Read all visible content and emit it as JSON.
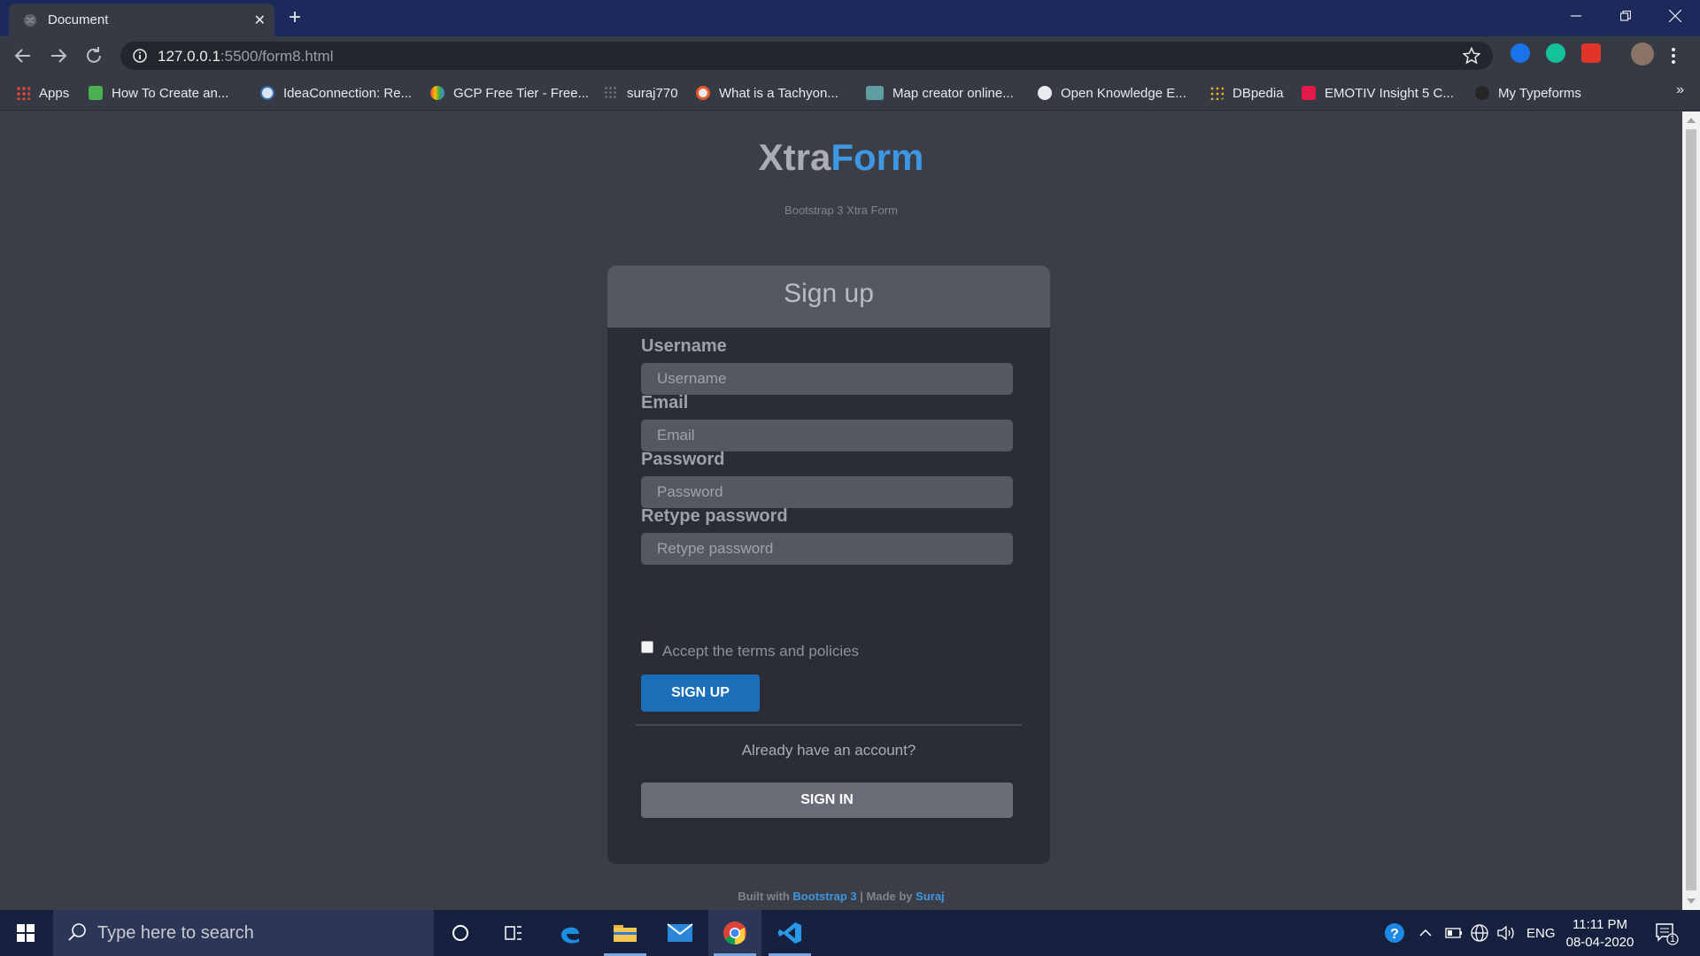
{
  "browser": {
    "tab_title": "Document",
    "new_tab": "+",
    "tab_close": "✕",
    "url_host": "127.0.0.1",
    "url_path": ":5500/form8.html",
    "bookmarks": [
      {
        "label": "Apps",
        "icon": "apps-grid-icon"
      },
      {
        "label": "How To Create an...",
        "icon": "bookmark-favicon-green"
      },
      {
        "label": "IdeaConnection: Re...",
        "icon": "bookmark-favicon-ideaconnection"
      },
      {
        "label": "GCP Free Tier - Free...",
        "icon": "google-cloud-icon"
      },
      {
        "label": "suraj770",
        "icon": "dots-favicon"
      },
      {
        "label": "What is a Tachyon...",
        "icon": "bookmark-favicon-tachyon"
      },
      {
        "label": "Map creator online...",
        "icon": "zeemaps-icon"
      },
      {
        "label": "Open Knowledge E...",
        "icon": "globe-favicon"
      },
      {
        "label": "DBpedia",
        "icon": "dbpedia-icon"
      },
      {
        "label": "EMOTIV Insight 5 C...",
        "icon": "emotiv-icon"
      },
      {
        "label": "My Typeforms",
        "icon": "typeform-icon"
      }
    ],
    "bookmarks_more": "»"
  },
  "page": {
    "brand_part1": "Xtra",
    "brand_part2": "Form",
    "subtitle": "Bootstrap 3 Xtra Form",
    "card_title": "Sign up",
    "fields": [
      {
        "label": "Username",
        "placeholder": "Username"
      },
      {
        "label": "Email",
        "placeholder": "Email"
      },
      {
        "label": "Password",
        "placeholder": "Password"
      },
      {
        "label": "Retype password",
        "placeholder": "Retype password"
      }
    ],
    "terms_label": "Accept the terms and policies",
    "signup_button": "SIGN UP",
    "already_text": "Already have an account?",
    "signin_button": "SIGN IN",
    "footer_built": "Built with ",
    "footer_link1": "Bootstrap 3",
    "footer_sep": " | Made by ",
    "footer_link2": "Suraj"
  },
  "taskbar": {
    "search_placeholder": "Type here to search",
    "language": "ENG",
    "time": "11:11 PM",
    "date": "08-04-2020",
    "notification_count": "1"
  },
  "colors": {
    "brand_accent": "#3d97e3",
    "signup_button": "#1b6eb8",
    "page_bg": "#3b3e47",
    "card_bg": "#2b2d36"
  }
}
